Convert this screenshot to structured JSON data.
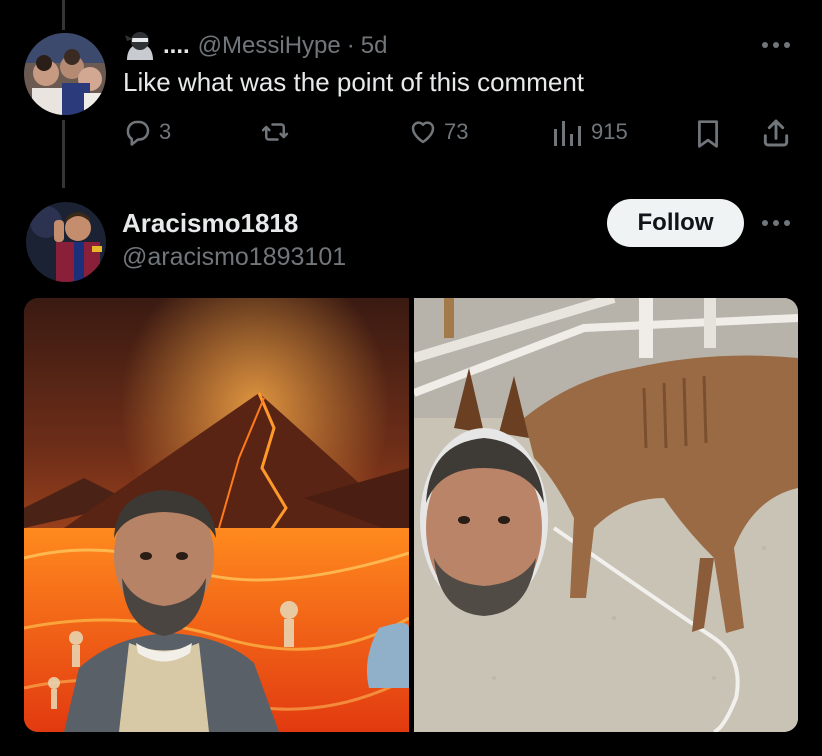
{
  "reply": {
    "name_prefix": "....",
    "handle": "@MessiHype",
    "separator": "·",
    "time": "5d",
    "text": "Like what was the point of this comment",
    "counts": {
      "replies": "3",
      "likes": "73",
      "views": "915"
    }
  },
  "post": {
    "display_name": "Aracismo1818",
    "handle": "@aracismo1893101",
    "follow_label": "Follow"
  },
  "icons": {
    "more": "more-horizontal-icon",
    "reply": "reply-bubble-icon",
    "repost": "repost-icon",
    "like": "heart-icon",
    "views": "analytics-bars-icon",
    "bookmark": "bookmark-icon",
    "share": "share-upload-icon"
  },
  "colors": {
    "background": "#000000",
    "text": "#e7e9ea",
    "muted": "#71767b",
    "follow_bg": "#eff3f4"
  }
}
